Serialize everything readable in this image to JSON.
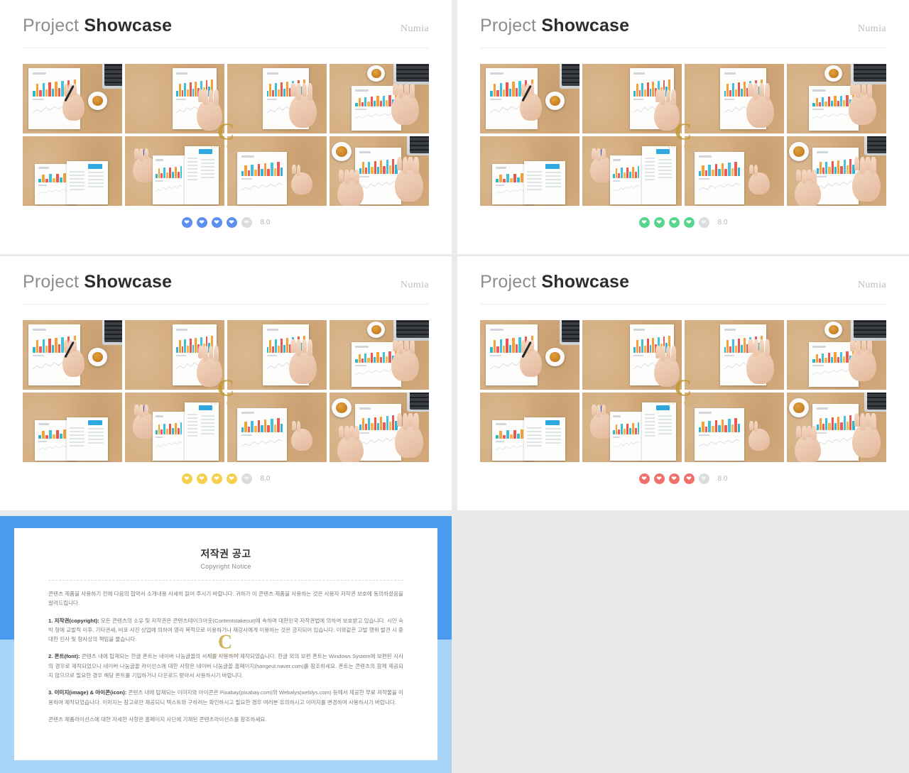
{
  "page": {
    "background_color": "#e9eaec",
    "panel_background": "#ffffff"
  },
  "showcase_panels": [
    {
      "title_light": "Project",
      "title_bold": "Showcase",
      "brand": "Numia",
      "accent_color": "#5b8ff0",
      "rating_icon": "heart-icon",
      "rating_filled": 4,
      "rating_total": 5,
      "score": "8.0"
    },
    {
      "title_light": "Project",
      "title_bold": "Showcase",
      "brand": "Numia",
      "accent_color": "#58d68d",
      "rating_icon": "heart-icon",
      "rating_filled": 4,
      "rating_total": 5,
      "score": "8.0"
    },
    {
      "title_light": "Project",
      "title_bold": "Showcase",
      "brand": "Numia",
      "accent_color": "#f7cf4e",
      "rating_icon": "heart-icon",
      "rating_filled": 4,
      "rating_total": 5,
      "score": "8.0"
    },
    {
      "title_light": "Project",
      "title_bold": "Showcase",
      "brand": "Numia",
      "accent_color": "#f0716b",
      "rating_icon": "heart-icon",
      "rating_filled": 4,
      "rating_total": 5,
      "score": "8.0"
    }
  ],
  "thumbnail_watermark": {
    "letter": "C",
    "caption": "CONTENTS"
  },
  "copyright": {
    "border_color_top": "#4a9bf0",
    "border_color_bottom": "#a9d5f8",
    "title": "저작권 공고",
    "subtitle": "Copyright Notice",
    "intro": "콘텐츠 제품을 사용하기 전에 다음의 협약서 소개내용 사세히 읽어 주시기 바랍니다. 귀하가 이 콘텐츠 제품을 사용하는 것은 사용자 저작권 보호에 동의하셨음을 알려드립니다.",
    "sections": [
      {
        "heading": "1. 저작권(copyright):",
        "body": " 모든 콘텐츠의 소유 및 저작권은 콘텐츠테이크아웃(Contentstakeout)에 속하며 대한민국 저작권법에 의하여 보호받고 있습니다. 시안 숙박 형에 교발적 이후, 기타권세, 비포 사진 상업에 의하여 영리 목적으로 이용하거나 재강사에게 이용하는 것은 금지되어 있습니다. 이와같은 고발 행위 발견 시 중대한 민사 및 형사상의 책임을 물습니다."
      },
      {
        "heading": "2. 폰트(font):",
        "body": " 콘텐츠 내에 탑재되는 한글 폰트는 네이버 나눔글꼴의 서체를 사용하여 제작되었습니다. 한글 외의 보편 폰트는 Windows System에 보편된 시사의 경우로 제작되었으니 네이버 나눔글꼴 라이선스에 대한 사항은 네이버 나눔글꼴 홈페이지(hangeul.naver.com)를 참조하세요. 폰트는 콘텐츠의 함께 제공되지 않으므로 필요한 경우 해당 폰트를 기입하거나 다운로드 받아서 사용하시기 바랍니다."
      },
      {
        "heading": "3. 이미지(image) & 아이콘(icon):",
        "body": " 콘텐츠 내에 탑재되는 이미지와 아이콘은 Pixabay(pixabay.com)와 Webalys(weblys.com) 등에서 제공한 무료 저작물을 이용하여 제작되었습니다. 이미지는 참고로만 제공되니 텍스트와 구하려는 확인하시고 필요한 경우 여러분 유의하시고 이미지를 변경하여 사용하시기 바랍니다."
      }
    ],
    "footer": "콘텐츠 제품라이선스에 대한 자세한 사항은 홈페이지 사단에 기재된 콘텐츠라이선스를 참조하세요."
  }
}
